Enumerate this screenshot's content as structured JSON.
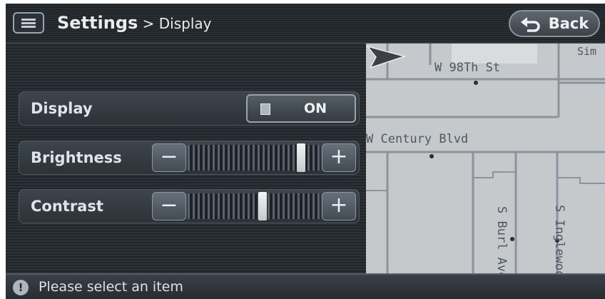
{
  "header": {
    "title_main": "Settings",
    "title_separator": " > ",
    "title_sub": "Display",
    "back_label": "Back",
    "menu_icon": "menu-list-icon",
    "back_icon": "back-arrow-icon"
  },
  "settings": {
    "display": {
      "label": "Display",
      "value": "ON",
      "enabled": true
    },
    "brightness": {
      "label": "Brightness",
      "minus": "−",
      "plus": "+",
      "level": 0.88
    },
    "contrast": {
      "label": "Contrast",
      "minus": "−",
      "plus": "+",
      "level": 0.57
    }
  },
  "map": {
    "streets": {
      "w98th": "W 98Th St",
      "century": "W Century Blvd",
      "simi": "Sim",
      "burl": "S Burl Ave",
      "inglewood": "S Inglewood"
    },
    "vehicle_icon": "vehicle-arrow-icon"
  },
  "status": {
    "text": "Please select an item",
    "icon": "info-icon"
  },
  "colors": {
    "background": "#1f2327",
    "map_background": "#c5c9cc",
    "road": "#8c939a",
    "text": "#e8ecef"
  }
}
